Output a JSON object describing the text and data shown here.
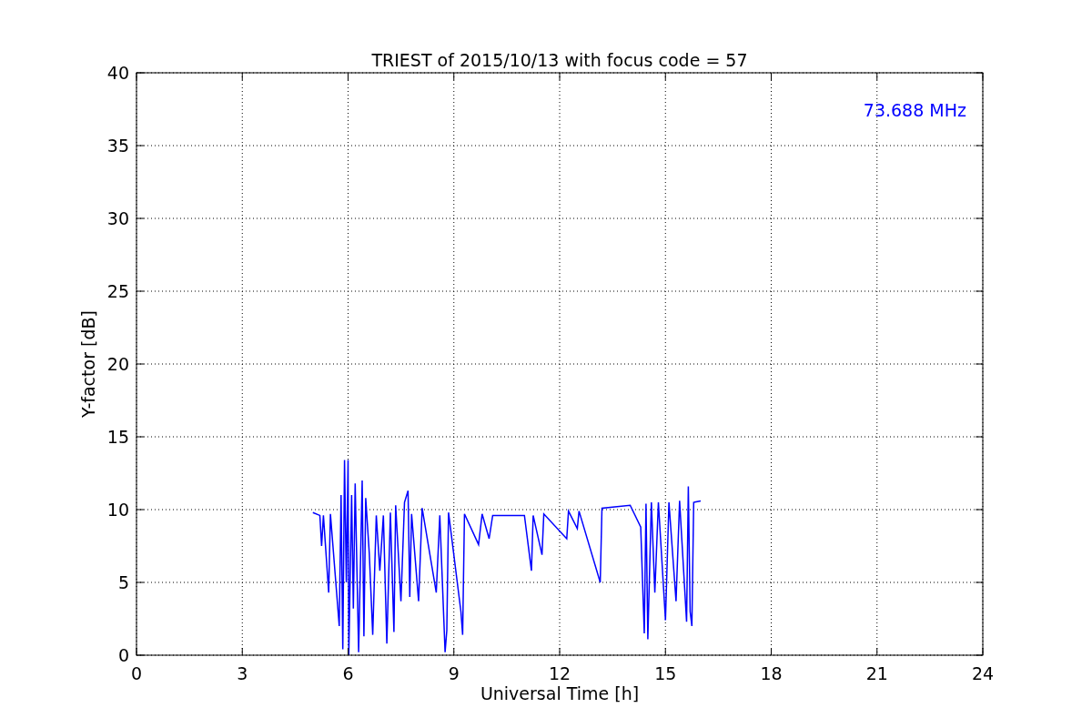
{
  "chart_data": {
    "type": "line",
    "title": "TRIEST of 2015/10/13 with focus code = 57",
    "xlabel": "Universal Time [h]",
    "ylabel": "Y-factor [dB]",
    "xlim": [
      0,
      24
    ],
    "ylim": [
      0,
      40
    ],
    "xticks": [
      0,
      3,
      6,
      9,
      12,
      15,
      18,
      21,
      24
    ],
    "yticks": [
      0,
      5,
      10,
      15,
      20,
      25,
      30,
      35,
      40
    ],
    "x": [
      5.0,
      5.2,
      5.25,
      5.3,
      5.45,
      5.5,
      5.75,
      5.8,
      5.85,
      5.9,
      5.95,
      6.0,
      6.02,
      6.1,
      6.15,
      6.2,
      6.3,
      6.4,
      6.45,
      6.5,
      6.6,
      6.7,
      6.8,
      6.9,
      7.0,
      7.1,
      7.2,
      7.3,
      7.35,
      7.5,
      7.6,
      7.7,
      7.75,
      7.8,
      8.0,
      8.1,
      8.5,
      8.6,
      8.75,
      8.8,
      8.85,
      9.2,
      9.25,
      9.3,
      9.7,
      9.8,
      10.0,
      10.1,
      11.0,
      11.2,
      11.25,
      11.5,
      11.55,
      12.2,
      12.25,
      12.5,
      12.55,
      13.15,
      13.2,
      14.0,
      14.3,
      14.4,
      14.45,
      14.5,
      14.6,
      14.7,
      14.8,
      15.0,
      15.1,
      15.3,
      15.4,
      15.6,
      15.65,
      15.7,
      15.75,
      15.8,
      16.0
    ],
    "series": [
      {
        "color": "#0000ff",
        "values": [
          9.8,
          9.6,
          7.5,
          9.6,
          4.3,
          9.7,
          2.0,
          11.0,
          0.4,
          13.4,
          5.0,
          13.4,
          0.0,
          11.0,
          3.2,
          11.8,
          0.2,
          12.0,
          1.3,
          10.8,
          7.0,
          1.4,
          9.6,
          5.8,
          9.6,
          0.8,
          9.8,
          1.6,
          10.3,
          3.7,
          10.5,
          11.3,
          4.0,
          9.7,
          3.7,
          10.1,
          4.3,
          9.6,
          0.2,
          1.7,
          9.8,
          3.0,
          1.4,
          9.7,
          7.6,
          9.7,
          8.0,
          9.6,
          9.6,
          5.8,
          9.6,
          6.9,
          9.7,
          8.0,
          9.9,
          8.7,
          9.9,
          5.0,
          10.1,
          10.3,
          8.8,
          1.5,
          10.4,
          1.1,
          10.5,
          4.3,
          10.5,
          2.4,
          10.5,
          3.7,
          10.6,
          2.3,
          11.6,
          3.0,
          2.0,
          10.5,
          10.6
        ]
      }
    ],
    "annotations": [
      {
        "text": "73.688 MHz"
      }
    ],
    "grid": true
  }
}
